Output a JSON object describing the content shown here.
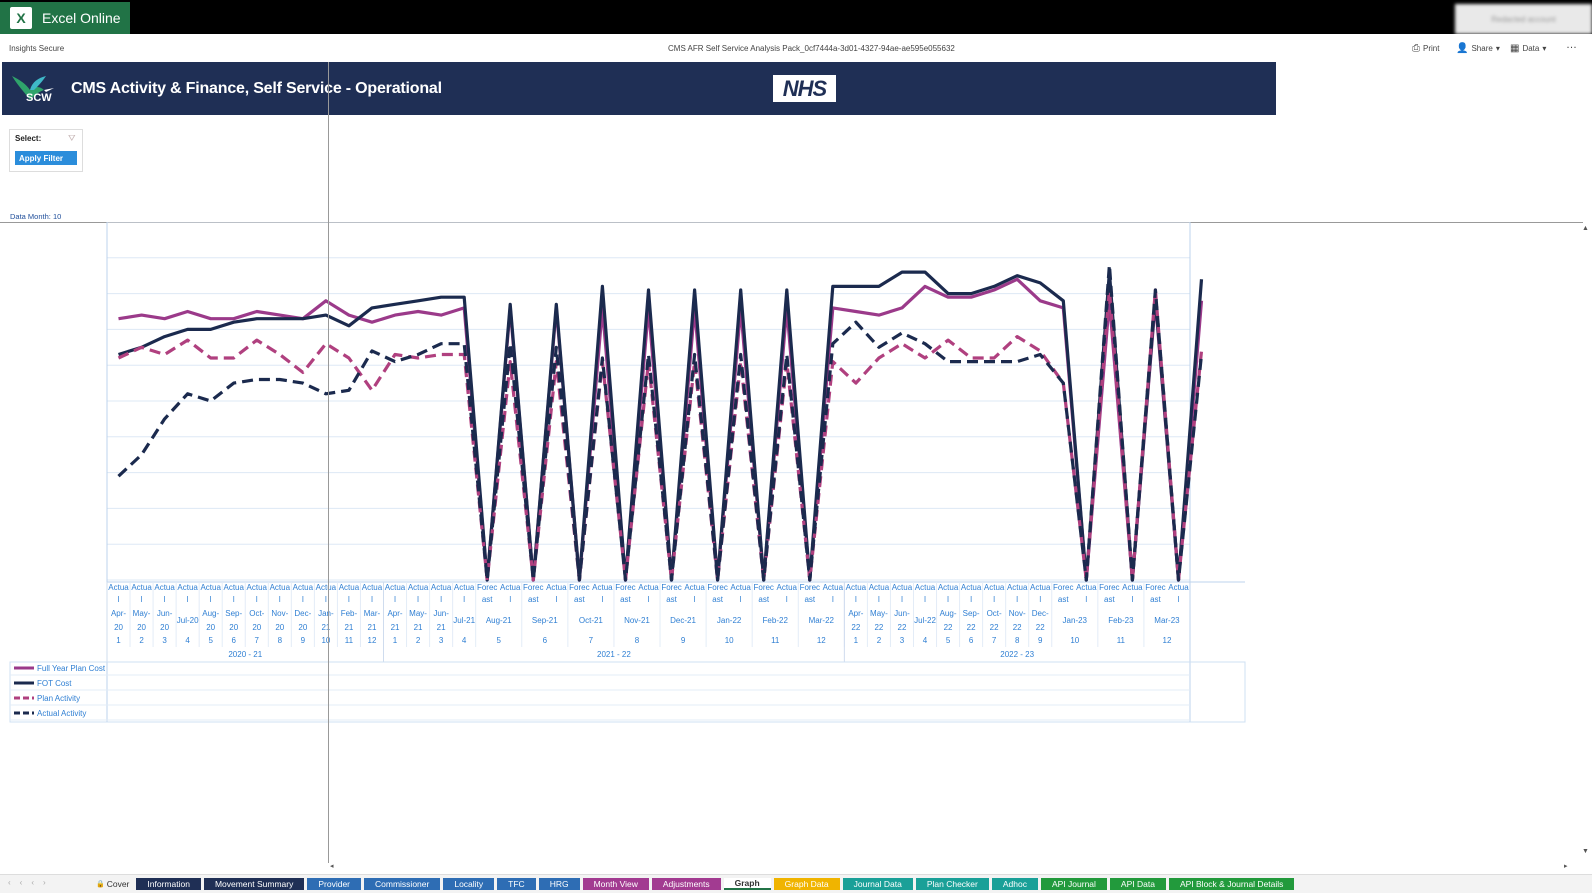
{
  "app": {
    "name": "Excel Online",
    "logo_letter": "X",
    "account": "Redacted account"
  },
  "subbar": {
    "org": "Insights Secure",
    "document": "CMS AFR Self Service Analysis Pack_0cf7444a-3d01-4327-94ae-ae595e055632",
    "print_label": "Print",
    "share_label": "Share",
    "data_label": "Data",
    "more_label": "…"
  },
  "banner": {
    "logo_text": "SCW",
    "title": "CMS Activity & Finance, Self Service - Operational",
    "nhs": "NHS",
    "bg_color": "#1f2f55"
  },
  "filter": {
    "select_label": "Select:",
    "apply_label": "Apply Filter"
  },
  "data_month": "Data Month: 10",
  "chart_data": {
    "type": "line",
    "x": [
      "Apr-20",
      "May-20",
      "Jun-20",
      "Jul-20",
      "Aug-20",
      "Sep-20",
      "Oct-20",
      "Nov-20",
      "Dec-20",
      "Jan-21",
      "Feb-21",
      "Mar-21",
      "Apr-21",
      "May-21",
      "Jun-21",
      "Jul-21",
      "Aug-21",
      "Aug-21",
      "Sep-21",
      "Sep-21",
      "Oct-21",
      "Oct-21",
      "Nov-21",
      "Nov-21",
      "Dec-21",
      "Dec-21",
      "Jan-22",
      "Jan-22",
      "Feb-22",
      "Feb-22",
      "Mar-22",
      "Mar-22",
      "Apr-22",
      "May-22",
      "Jun-22",
      "Jul-22",
      "Aug-22",
      "Sep-22",
      "Oct-22",
      "Nov-22",
      "Dec-22",
      "Jan-23",
      "Jan-23",
      "Feb-23",
      "Feb-23",
      "Mar-23",
      "Mar-23"
    ],
    "row1": [
      "Actual",
      "Actual",
      "Actual",
      "Actual",
      "Actual",
      "Actual",
      "Actual",
      "Actual",
      "Actual",
      "Actual",
      "Actual",
      "Actual",
      "Actual",
      "Actual",
      "Actual",
      "Actual",
      "Forecast",
      "Actual",
      "Forecast",
      "Actual",
      "Forecast",
      "Actual",
      "Forecast",
      "Actual",
      "Forecast",
      "Actual",
      "Forecast",
      "Actual",
      "Forecast",
      "Actual",
      "Forecast",
      "Actual",
      "Actual",
      "Actual",
      "Actual",
      "Actual",
      "Actual",
      "Actual",
      "Actual",
      "Actual",
      "Actual",
      "Forecast",
      "Actual",
      "Forecast",
      "Actual",
      "Forecast",
      "Actual"
    ],
    "month_labels": [
      "Apr-20",
      "May-20",
      "Jun-20",
      "Jul-20",
      "Aug-20",
      "Sep-20",
      "Oct-20",
      "Nov-20",
      "Dec-20",
      "Jan-21",
      "Feb-21",
      "Mar-21",
      "Apr-21",
      "May-21",
      "Jun-21",
      "Jul-21",
      "Aug-21",
      "Sep-21",
      "Oct-21",
      "Nov-21",
      "Dec-21",
      "Jan-22",
      "Feb-22",
      "Mar-22",
      "Apr-22",
      "May-22",
      "Jun-22",
      "Jul-22",
      "Aug-22",
      "Sep-22",
      "Oct-22",
      "Nov-22",
      "Dec-22",
      "Jan-23",
      "Feb-23",
      "Mar-23"
    ],
    "month_nums": [
      1,
      2,
      3,
      4,
      5,
      6,
      7,
      8,
      9,
      10,
      11,
      12,
      1,
      2,
      3,
      4,
      5,
      6,
      7,
      8,
      9,
      10,
      11,
      12,
      1,
      2,
      3,
      4,
      5,
      6,
      7,
      8,
      9,
      10,
      11,
      12
    ],
    "years": [
      "2020 - 21",
      "2021 - 22",
      "2022 - 23"
    ],
    "ylim_left": [
      0,
      10
    ],
    "series": [
      {
        "name": "Full Year Plan Cost",
        "color": "#9b3a8a",
        "dash": false,
        "values": [
          7.3,
          7.4,
          7.3,
          7.5,
          7.3,
          7.3,
          7.5,
          7.4,
          7.3,
          7.8,
          7.4,
          7.2,
          7.4,
          7.5,
          7.4,
          7.6,
          0,
          7.6,
          0,
          7.6,
          0,
          7.6,
          0,
          7.6,
          0,
          7.6,
          0,
          7.6,
          0,
          7.6,
          0,
          7.6,
          7.5,
          7.4,
          7.6,
          8.2,
          7.9,
          7.9,
          8.1,
          8.4,
          7.8,
          7.6,
          0,
          7.8,
          0,
          7.8,
          0,
          7.8
        ]
      },
      {
        "name": "FOT Cost",
        "color": "#1b2a4e",
        "dash": false,
        "values": [
          6.3,
          6.5,
          6.8,
          7.0,
          7.0,
          7.2,
          7.3,
          7.3,
          7.3,
          7.4,
          7.1,
          7.6,
          7.7,
          7.8,
          7.9,
          7.9,
          0,
          7.7,
          0,
          7.7,
          0,
          8.2,
          0,
          8.1,
          0,
          8.1,
          0,
          8.1,
          0,
          8.1,
          0,
          8.2,
          8.2,
          8.2,
          8.6,
          8.6,
          8.0,
          8.0,
          8.2,
          8.5,
          8.3,
          7.8,
          0,
          8.6,
          0,
          7.9,
          0,
          8.4
        ]
      },
      {
        "name": "Plan Activity",
        "color": "#b0407f",
        "dash": true,
        "values": [
          6.2,
          6.5,
          6.3,
          6.7,
          6.2,
          6.2,
          6.7,
          6.3,
          5.8,
          6.6,
          6.2,
          5.3,
          6.3,
          6.2,
          6.3,
          6.3,
          0,
          6.1,
          0,
          6.1,
          0,
          6.1,
          0,
          6.1,
          0,
          6.1,
          0,
          6.1,
          0,
          6.1,
          0,
          6.1,
          5.5,
          6.2,
          6.6,
          6.2,
          6.7,
          6.2,
          6.2,
          6.8,
          6.4,
          5.5,
          0,
          8.1,
          0,
          8.1,
          0,
          6.4
        ]
      },
      {
        "name": "Actual Activity",
        "color": "#1b2a4e",
        "dash": true,
        "values": [
          2.9,
          3.5,
          4.5,
          5.2,
          5.0,
          5.5,
          5.6,
          5.6,
          5.5,
          5.2,
          5.3,
          6.4,
          6.1,
          6.3,
          6.6,
          6.6,
          0,
          6.6,
          0,
          6.5,
          0,
          6.2,
          0,
          6.3,
          0,
          6.3,
          0,
          6.3,
          0,
          6.3,
          0,
          6.6,
          7.2,
          6.5,
          6.9,
          6.6,
          6.1,
          6.1,
          6.1,
          6.1,
          6.3,
          5.5,
          0,
          8.8,
          0,
          8.1,
          0,
          6.3
        ]
      }
    ],
    "legend_position": "bottom-left"
  },
  "sheet_tabs": [
    {
      "label": "Cover",
      "color": "transparent",
      "kind": "cover"
    },
    {
      "label": "Information",
      "color": "#1f2f55"
    },
    {
      "label": "Movement Summary",
      "color": "#1f2f55"
    },
    {
      "label": "Provider",
      "color": "#2e6db4"
    },
    {
      "label": "Commissioner",
      "color": "#2e6db4"
    },
    {
      "label": "Locality",
      "color": "#2e6db4"
    },
    {
      "label": "TFC",
      "color": "#2e6db4"
    },
    {
      "label": "HRG",
      "color": "#2e6db4"
    },
    {
      "label": "Month View",
      "color": "#a23b91"
    },
    {
      "label": "Adjustments",
      "color": "#a23b91"
    },
    {
      "label": "Graph",
      "color": "#ffffff",
      "kind": "active"
    },
    {
      "label": "Graph Data",
      "color": "#f0b400"
    },
    {
      "label": "Journal Data",
      "color": "#1aa098"
    },
    {
      "label": "Plan Checker",
      "color": "#1aa098"
    },
    {
      "label": "Adhoc",
      "color": "#1aa098"
    },
    {
      "label": "API Journal",
      "color": "#229a3c"
    },
    {
      "label": "API Data",
      "color": "#229a3c"
    },
    {
      "label": "API Block & Journal Details",
      "color": "#229a3c"
    }
  ]
}
